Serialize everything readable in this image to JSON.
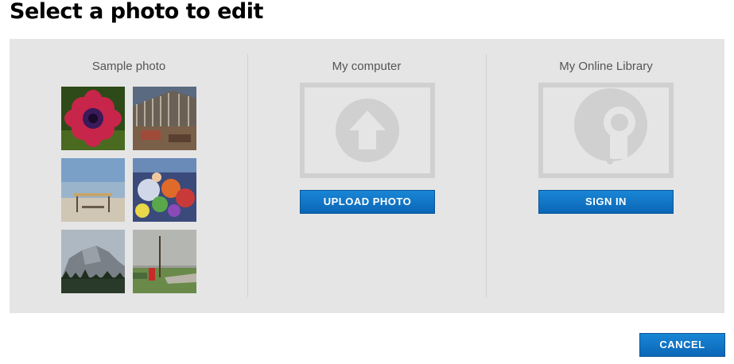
{
  "page": {
    "title": "Select a photo to edit"
  },
  "columns": {
    "sample": {
      "title": "Sample photo",
      "photos": [
        "flower-photo",
        "barn-photo",
        "beach-photo",
        "parade-photo",
        "mountain-photo",
        "countryside-photo"
      ]
    },
    "computer": {
      "title": "My computer",
      "icon": "upload-arrow-icon",
      "button": "UPLOAD PHOTO"
    },
    "library": {
      "title": "My Online Library",
      "icon": "speech-bubble-icon",
      "button": "SIGN IN"
    }
  },
  "footer": {
    "cancel": "CANCEL"
  },
  "colors": {
    "panel": "#e5e5e5",
    "button": "#0a72c4",
    "placeholder": "#d0d0d0"
  }
}
